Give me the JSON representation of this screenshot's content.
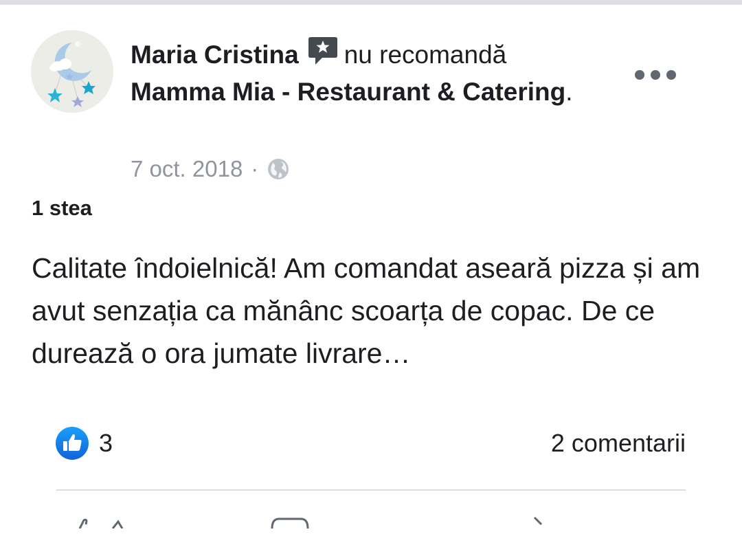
{
  "post": {
    "author": "Maria Cristina",
    "action_text": "nu recomandă",
    "page_name": "Mamma Mia - Restaurant & Catering",
    "page_suffix": ".",
    "date": "7 oct. 2018",
    "separator": "·",
    "privacy_icon": "globe-icon",
    "rating_label": "1 stea",
    "body": "Calitate îndoielnică! Am comandat aseară pizza și am avut senzația ca mănânc scoarța de copac. De ce durează o ora jumate livrare…",
    "reactions": {
      "icon": "like-icon",
      "count": "3"
    },
    "comments_label": "2 comentarii"
  },
  "colors": {
    "like_blue": "#1877f2",
    "muted_text": "#90949c",
    "main_text": "#1c1e21",
    "review_icon": "#444950"
  }
}
